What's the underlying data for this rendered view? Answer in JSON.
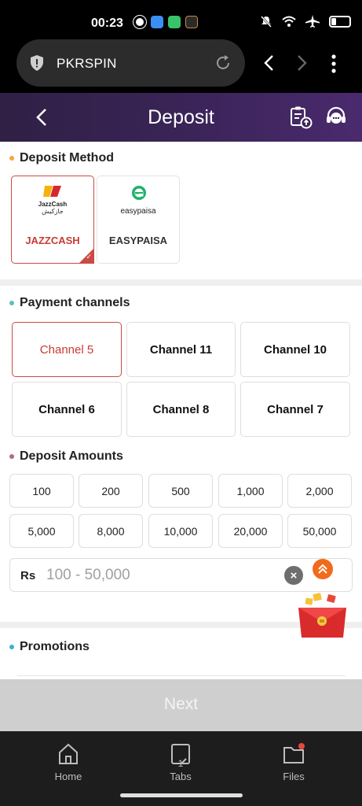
{
  "status_bar": {
    "time": "00:23"
  },
  "browser": {
    "url_text": "PKRSPIN"
  },
  "header": {
    "title": "Deposit"
  },
  "deposit_method": {
    "title": "Deposit Method",
    "dot_color": "#f2a93b",
    "methods": [
      {
        "label": "JAZZCASH",
        "logo_text": "JazzCash",
        "logo_subtext": "جازکیش",
        "selected": true
      },
      {
        "label": "EASYPAISA",
        "logo_text": "easypaisa",
        "selected": false
      }
    ]
  },
  "payment_channels": {
    "title": "Payment channels",
    "dot_color": "#5bc0c4",
    "channels": [
      "Channel 5",
      "Channel 11",
      "Channel 10",
      "Channel 6",
      "Channel 8",
      "Channel 7"
    ],
    "selected": "Channel 5"
  },
  "deposit_amounts": {
    "title": "Deposit Amounts",
    "dot_color": "#b06a88",
    "amounts": [
      "100",
      "200",
      "500",
      "1,000",
      "2,000",
      "5,000",
      "8,000",
      "10,000",
      "20,000",
      "50,000"
    ],
    "currency_label": "Rs",
    "input_placeholder": "100 - 50,000"
  },
  "promotions": {
    "title": "Promotions",
    "dot_color": "#3bb0d8"
  },
  "next_button": {
    "label": "Next"
  },
  "bottom_nav": {
    "items": [
      "Home",
      "Tabs",
      "Files"
    ],
    "tab_count": "1"
  },
  "colors": {
    "accent_red": "#c93a33",
    "header_purple": "#3a2457",
    "scroll_top_orange": "#f26a1b"
  }
}
